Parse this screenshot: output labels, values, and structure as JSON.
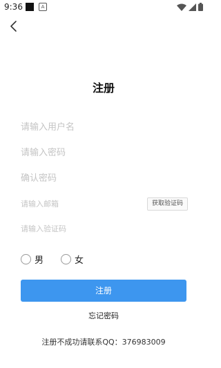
{
  "status_bar": {
    "time": "9:36",
    "notification_letter": "A",
    "icons": [
      "wifi-icon",
      "cellular-signal-icon",
      "battery-icon"
    ]
  },
  "header": {
    "back_icon": "chevron-left-icon"
  },
  "page": {
    "title": "注册"
  },
  "form": {
    "username_placeholder": "请输入用户名",
    "password_placeholder": "请输入密码",
    "confirm_password_placeholder": "确认密码",
    "email_placeholder": "请输入邮箱",
    "get_code_label": "获取验证码",
    "code_placeholder": "请输入验证码",
    "gender_options": [
      "男",
      "女"
    ],
    "register_label": "注册",
    "forgot_password_label": "忘记密码"
  },
  "footer": {
    "contact_text": "注册不成功请联系QQ：376983009"
  },
  "colors": {
    "primary_button": "#3d96ef",
    "placeholder": "#c4c4c4"
  }
}
